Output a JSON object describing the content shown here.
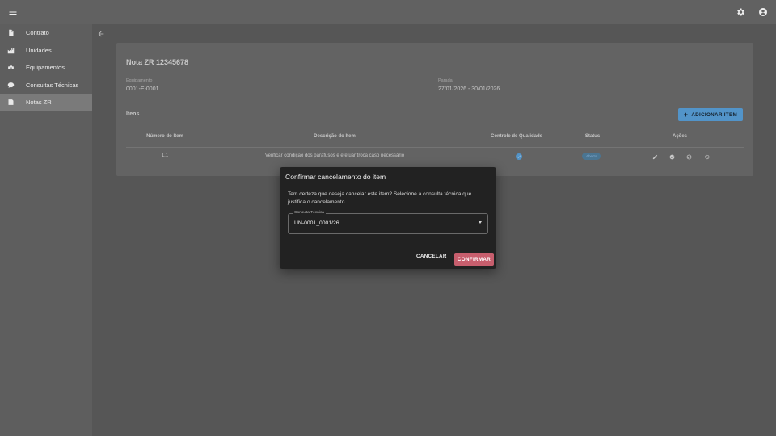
{
  "sidebar": {
    "items": [
      {
        "label": "Contrato",
        "icon": "document-icon"
      },
      {
        "label": "Unidades",
        "icon": "factory-icon"
      },
      {
        "label": "Equipamentos",
        "icon": "equipment-icon"
      },
      {
        "label": "Consultas Técnicas",
        "icon": "chat-bubble-icon"
      },
      {
        "label": "Notas ZR",
        "icon": "note-icon",
        "active": true
      }
    ]
  },
  "nota": {
    "title": "Nota ZR 12345678",
    "equipamento_label": "Equipamento",
    "equipamento_value": "0001-E-0001",
    "parada_label": "Parada",
    "parada_value": "27/01/2026 - 30/01/2026",
    "items_title": "Itens",
    "add_button": "ADICIONAR ITEM"
  },
  "table": {
    "headers": [
      "Número do Item",
      "Descrição do Item",
      "Controle de Qualidade",
      "Status",
      "Ações"
    ],
    "rows": [
      {
        "numero": "1.1",
        "descricao": "Verificar condição dos parafusos e efetuar troca caso necessário",
        "controle_qualidade": true,
        "status": "Aberto"
      }
    ]
  },
  "dialog": {
    "title": "Confirmar cancelamento do item",
    "message": "Tem certeza que deseja cancelar este item? Selecione a consulta técnica que justifica o cancelamento.",
    "select_label": "Consulta Técnica",
    "select_value": "UN-0001_0001/26",
    "cancel": "CANCELAR",
    "confirm": "CONFIRMAR"
  },
  "colors": {
    "accent": "#64b5f6",
    "danger": "#c75e6d",
    "dialog_bg": "#222222"
  }
}
